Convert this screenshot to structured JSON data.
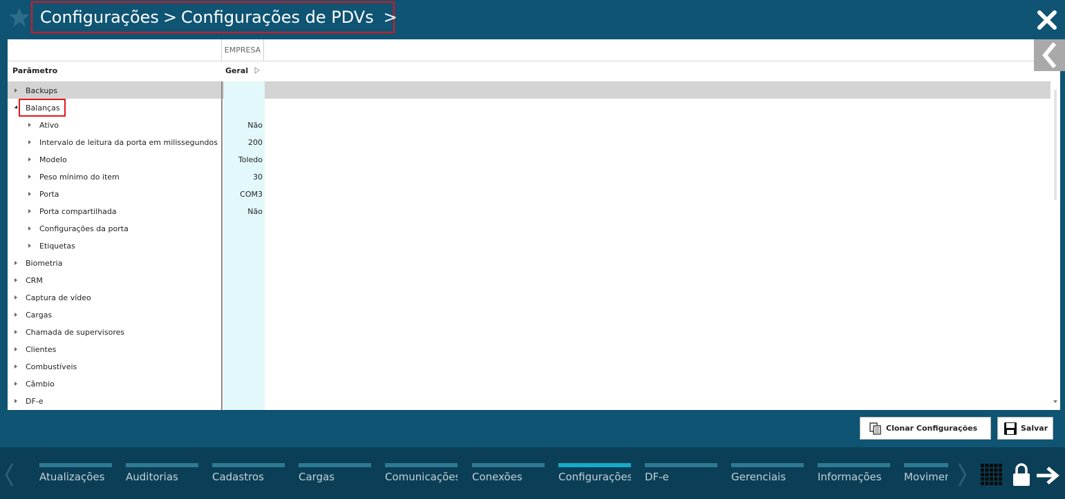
{
  "header": {
    "breadcrumb": [
      "Configurações",
      "Configurações de PDVs"
    ],
    "chevron": ">"
  },
  "grid": {
    "group_header": "EMPRESA",
    "col_param": "Parâmetro",
    "col_value": "Geral",
    "rows": [
      {
        "label": "Backups",
        "value": ""
      },
      {
        "label": "Balanças",
        "value": ""
      },
      {
        "label": "Ativo",
        "value": "Não"
      },
      {
        "label": "Intervalo de leitura da porta em milissegundos",
        "value": "200"
      },
      {
        "label": "Modelo",
        "value": "Toledo"
      },
      {
        "label": "Peso mínimo do item",
        "value": "30"
      },
      {
        "label": "Porta",
        "value": "COM3"
      },
      {
        "label": "Porta compartilhada",
        "value": "Não"
      },
      {
        "label": "Configurações da porta",
        "value": ""
      },
      {
        "label": "Etiquetas",
        "value": ""
      },
      {
        "label": "Biometria",
        "value": ""
      },
      {
        "label": "CRM",
        "value": ""
      },
      {
        "label": "Captura de vídeo",
        "value": ""
      },
      {
        "label": "Cargas",
        "value": ""
      },
      {
        "label": "Chamada de supervisores",
        "value": ""
      },
      {
        "label": "Clientes",
        "value": ""
      },
      {
        "label": "Combustíveis",
        "value": ""
      },
      {
        "label": "Câmbio",
        "value": ""
      },
      {
        "label": "DF-e",
        "value": ""
      }
    ]
  },
  "actions": {
    "clone_label": "Clonar Configurações",
    "save_label": "Salvar"
  },
  "bottom_nav": {
    "items": [
      {
        "label": "Atualizações",
        "active": false
      },
      {
        "label": "Auditorias",
        "active": false
      },
      {
        "label": "Cadastros",
        "active": false
      },
      {
        "label": "Cargas",
        "active": false
      },
      {
        "label": "Comunicações",
        "active": false
      },
      {
        "label": "Conexões",
        "active": false
      },
      {
        "label": "Configurações",
        "active": true
      },
      {
        "label": "DF-e",
        "active": false
      },
      {
        "label": "Gerenciais",
        "active": false
      },
      {
        "label": "Informações",
        "active": false
      },
      {
        "label": "Movimentos",
        "active": false
      }
    ]
  },
  "colors": {
    "background": "#0f5473",
    "footer": "#0a3f57",
    "highlight_border": "#e3141c",
    "active_tab": "#17aac8",
    "value_column": "#e2f8fa"
  }
}
